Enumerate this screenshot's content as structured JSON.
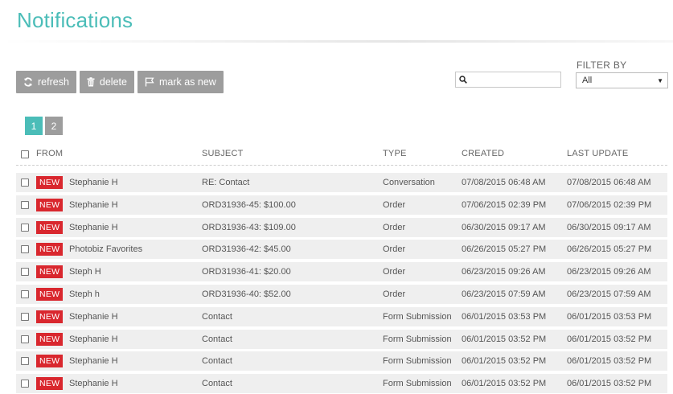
{
  "page": {
    "title": "Notifications"
  },
  "toolbar": {
    "refresh_label": "refresh",
    "delete_label": "delete",
    "mark_new_label": "mark as new"
  },
  "search": {
    "value": "",
    "placeholder": ""
  },
  "filter": {
    "label": "FILTER BY",
    "selected": "All"
  },
  "pagination": {
    "pages": [
      "1",
      "2"
    ],
    "current": "1"
  },
  "table": {
    "headers": {
      "from": "FROM",
      "subject": "SUBJECT",
      "type": "TYPE",
      "created": "CREATED",
      "updated": "LAST UPDATE"
    },
    "badge_label": "NEW",
    "rows": [
      {
        "from": "Stephanie H",
        "subject": "RE: Contact",
        "type": "Conversation",
        "created": "07/08/2015 06:48 AM",
        "updated": "07/08/2015 06:48 AM"
      },
      {
        "from": "Stephanie H",
        "subject": "ORD31936-45: $100.00",
        "type": "Order",
        "created": "07/06/2015 02:39 PM",
        "updated": "07/06/2015 02:39 PM"
      },
      {
        "from": "Stephanie H",
        "subject": "ORD31936-43: $109.00",
        "type": "Order",
        "created": "06/30/2015 09:17 AM",
        "updated": "06/30/2015 09:17 AM"
      },
      {
        "from": "Photobiz Favorites",
        "subject": "ORD31936-42: $45.00",
        "type": "Order",
        "created": "06/26/2015 05:27 PM",
        "updated": "06/26/2015 05:27 PM"
      },
      {
        "from": "Steph H",
        "subject": "ORD31936-41: $20.00",
        "type": "Order",
        "created": "06/23/2015 09:26 AM",
        "updated": "06/23/2015 09:26 AM"
      },
      {
        "from": "Steph h",
        "subject": "ORD31936-40: $52.00",
        "type": "Order",
        "created": "06/23/2015 07:59 AM",
        "updated": "06/23/2015 07:59 AM"
      },
      {
        "from": "Stephanie H",
        "subject": "Contact",
        "type": "Form Submission",
        "created": "06/01/2015 03:53 PM",
        "updated": "06/01/2015 03:53 PM"
      },
      {
        "from": "Stephanie H",
        "subject": "Contact",
        "type": "Form Submission",
        "created": "06/01/2015 03:52 PM",
        "updated": "06/01/2015 03:52 PM"
      },
      {
        "from": "Stephanie H",
        "subject": "Contact",
        "type": "Form Submission",
        "created": "06/01/2015 03:52 PM",
        "updated": "06/01/2015 03:52 PM"
      },
      {
        "from": "Stephanie H",
        "subject": "Contact",
        "type": "Form Submission",
        "created": "06/01/2015 03:52 PM",
        "updated": "06/01/2015 03:52 PM"
      }
    ]
  },
  "colors": {
    "accent": "#4bbdb8",
    "badge": "#d9272e",
    "button": "#9d9d9d",
    "row_bg": "#efefef"
  },
  "icons": [
    "refresh-icon",
    "trash-icon",
    "flag-icon",
    "search-icon",
    "chevron-down-icon"
  ]
}
